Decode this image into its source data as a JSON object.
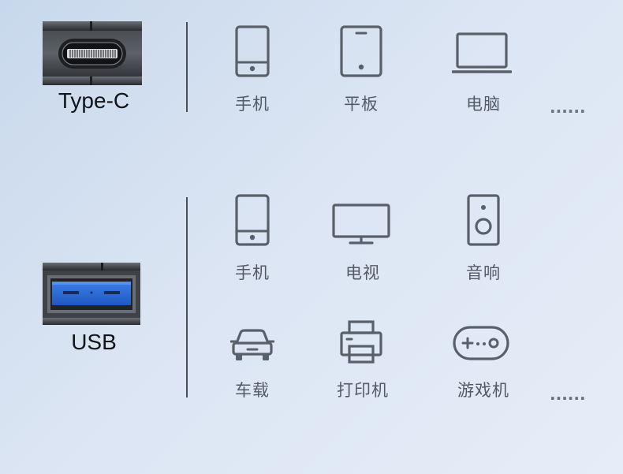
{
  "sections": [
    {
      "connector": "Type-C",
      "devices": [
        {
          "label": "手机",
          "icon": "phone-icon"
        },
        {
          "label": "平板",
          "icon": "tablet-icon"
        },
        {
          "label": "电脑",
          "icon": "laptop-icon"
        }
      ],
      "more": "......"
    },
    {
      "connector": "USB",
      "devices": [
        {
          "label": "手机",
          "icon": "phone-icon"
        },
        {
          "label": "电视",
          "icon": "tv-icon"
        },
        {
          "label": "音响",
          "icon": "speaker-icon"
        },
        {
          "label": "车载",
          "icon": "car-icon"
        },
        {
          "label": "打印机",
          "icon": "printer-icon"
        },
        {
          "label": "游戏机",
          "icon": "gamepad-icon"
        }
      ],
      "more": "......"
    }
  ],
  "colors": {
    "icon_stroke": "#5a6069",
    "usb_blue": "#2f6fd8",
    "connector_metal": "#3a3d42"
  }
}
